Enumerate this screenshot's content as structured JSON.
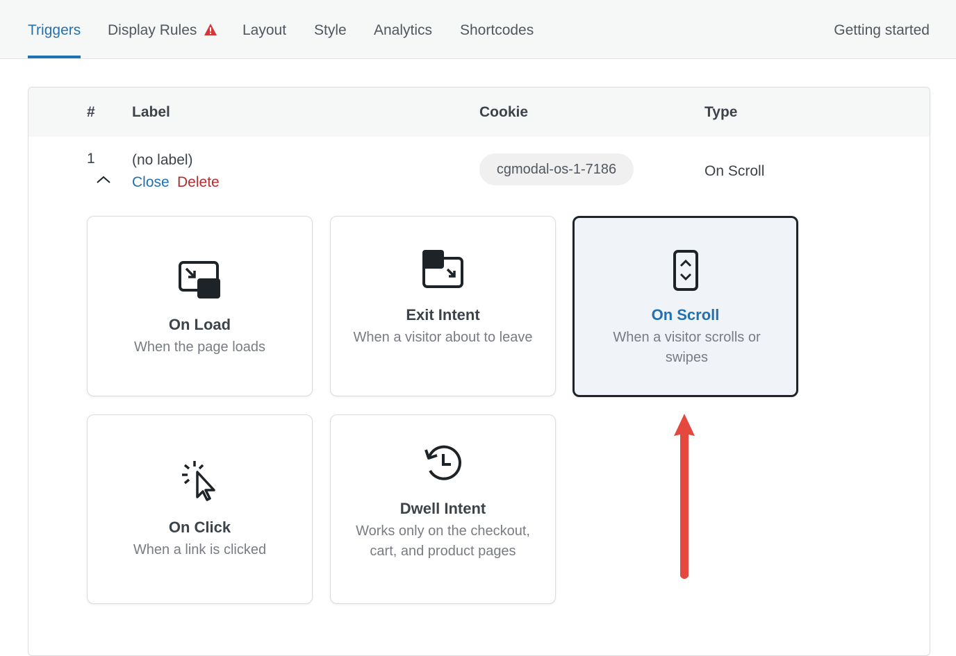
{
  "tabs": [
    {
      "label": "Triggers",
      "active": true
    },
    {
      "label": "Display Rules",
      "warning": true
    },
    {
      "label": "Layout"
    },
    {
      "label": "Style"
    },
    {
      "label": "Analytics"
    },
    {
      "label": "Shortcodes"
    }
  ],
  "getting_started": "Getting started",
  "table": {
    "headers": {
      "index": "#",
      "label": "Label",
      "cookie": "Cookie",
      "type": "Type"
    },
    "row": {
      "index": "1",
      "label": "(no label)",
      "close": "Close",
      "delete": "Delete",
      "cookie": "cgmodal-os-1-7186",
      "type": "On Scroll"
    }
  },
  "triggers": [
    {
      "title": "On Load",
      "desc": "When the page loads",
      "icon": "on-load-icon"
    },
    {
      "title": "Exit Intent",
      "desc": "When a visitor about to leave",
      "icon": "exit-intent-icon"
    },
    {
      "title": "On Scroll",
      "desc": "When a visitor scrolls or swipes",
      "icon": "scroll-icon",
      "selected": true
    },
    {
      "title": "On Click",
      "desc": "When a link is clicked",
      "icon": "click-cursor-icon"
    },
    {
      "title": "Dwell Intent",
      "desc": "Works only on the checkout, cart, and product pages",
      "icon": "history-clock-icon"
    }
  ],
  "colors": {
    "accent": "#2271b1",
    "danger": "#b32d2e",
    "warning": "#d63638",
    "annotation_arrow": "#e5483f"
  }
}
